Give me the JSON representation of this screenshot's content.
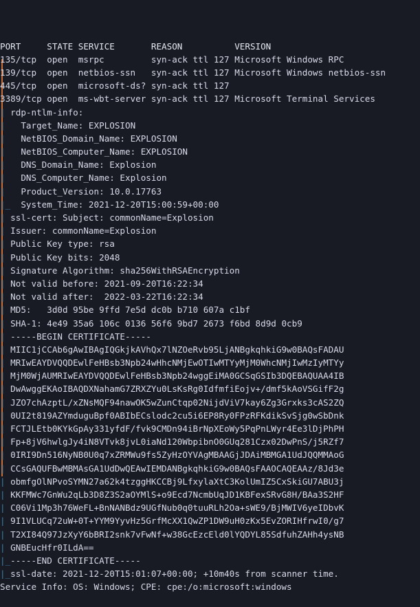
{
  "terminal": {
    "background_color": "#181a24",
    "foreground_color": "#d8dce8",
    "pipe_color": "#3d7fa6",
    "rule_color": "#c9703a",
    "columns_header": "PORT     STATE SERVICE       REASON          VERSION",
    "lines": [
      {
        "prefix": "",
        "text": "PORT     STATE SERVICE       REASON          VERSION",
        "kind": "header"
      },
      {
        "prefix": "",
        "text": "135/tcp  open  msrpc         syn-ack ttl 127 Microsoft Windows RPC",
        "kind": "port"
      },
      {
        "prefix": "",
        "text": "139/tcp  open  netbios-ssn   syn-ack ttl 127 Microsoft Windows netbios-ssn",
        "kind": "port"
      },
      {
        "prefix": "",
        "text": "445/tcp  open  microsoft-ds? syn-ack ttl 127",
        "kind": "port"
      },
      {
        "prefix": "",
        "text": "3389/tcp open  ms-wbt-server syn-ack ttl 127 Microsoft Terminal Services",
        "kind": "port"
      },
      {
        "prefix": "|",
        "text": " rdp-ntlm-info: ",
        "kind": "script"
      },
      {
        "prefix": "|",
        "text": "   Target_Name: EXPLOSION",
        "kind": "script"
      },
      {
        "prefix": "|",
        "text": "   NetBIOS_Domain_Name: EXPLOSION",
        "kind": "script"
      },
      {
        "prefix": "|",
        "text": "   NetBIOS_Computer_Name: EXPLOSION",
        "kind": "script"
      },
      {
        "prefix": "|",
        "text": "   DNS_Domain_Name: Explosion",
        "kind": "script"
      },
      {
        "prefix": "|",
        "text": "   DNS_Computer_Name: Explosion",
        "kind": "script"
      },
      {
        "prefix": "|",
        "text": "   Product_Version: 10.0.17763",
        "kind": "script"
      },
      {
        "prefix": "|_",
        "text": "  System_Time: 2021-12-20T15:00:59+00:00",
        "kind": "script"
      },
      {
        "prefix": "|",
        "text": " ssl-cert: Subject: commonName=Explosion",
        "kind": "script"
      },
      {
        "prefix": "|",
        "text": " Issuer: commonName=Explosion",
        "kind": "script"
      },
      {
        "prefix": "|",
        "text": " Public Key type: rsa",
        "kind": "script"
      },
      {
        "prefix": "|",
        "text": " Public Key bits: 2048",
        "kind": "script"
      },
      {
        "prefix": "|",
        "text": " Signature Algorithm: sha256WithRSAEncryption",
        "kind": "script"
      },
      {
        "prefix": "|",
        "text": " Not valid before: 2021-09-20T16:22:34",
        "kind": "script"
      },
      {
        "prefix": "|",
        "text": " Not valid after:  2022-03-22T16:22:34",
        "kind": "script"
      },
      {
        "prefix": "|",
        "text": " MD5:   3d0d 95be 9ffd 7e5d dc0b b710 607a c1bf",
        "kind": "script"
      },
      {
        "prefix": "|",
        "text": " SHA-1: 4e49 35a6 106c 0136 56f6 9bd7 2673 f6bd 8d9d 0cb9",
        "kind": "script"
      },
      {
        "prefix": "|",
        "text": " -----BEGIN CERTIFICATE-----",
        "kind": "script"
      },
      {
        "prefix": "|",
        "text": " MIIC1jCCAb6gAwIBAgIQGkjkAVhQx7lNZOeRvb95LjANBgkqhkiG9w0BAQsFADAU",
        "kind": "b64"
      },
      {
        "prefix": "|",
        "text": " MRIwEAYDVQQDEwlFeHBsb3Npb24wHhcNMjEwOTIwMTYyMjM0WhcNMjIwMzIyMTYy",
        "kind": "b64"
      },
      {
        "prefix": "|",
        "text": " MjM0WjAUMRIwEAYDVQQDEwlFeHBsb3Npb24wggEiMA0GCSqGSIb3DQEBAQUAA4IB",
        "kind": "b64"
      },
      {
        "prefix": "|",
        "text": " DwAwggEKAoIBAQDXNahamG7ZRXZYu0LsKsRg0IdfmfiEojv+/dmf5kAoVSGifF2g",
        "kind": "b64"
      },
      {
        "prefix": "|",
        "text": " JZO7chAzptL/xZNsMQF94nawOK5wZunCtqp02NijdViV7kay6Zg3Grxks3cAS2ZQ",
        "kind": "b64"
      },
      {
        "prefix": "|",
        "text": " 0UI2t819AZYmduguBpf0ABIbECslodc2cu5i6EP8Ry0FPzRFKdikSvSjg0wSbDnk",
        "kind": "b64"
      },
      {
        "prefix": "|",
        "text": " FCTJLEtb0KYkGpAy331yfdF/fvk9CMDn94iBrNpXEoWy5PqPnLWyr4Ee3lDjPhPH",
        "kind": "b64"
      },
      {
        "prefix": "|",
        "text": " Fp+8jV6hwlgJy4iN8VTvk8jvL0iaNd120WbpibnO0GUq281Czx02DwPnS/j5RZf7",
        "kind": "b64"
      },
      {
        "prefix": "|",
        "text": " 0IRI9Dn516NyNB0U0q7xZRMWu9fs5ZyHzOYVAgMBAAGjJDAiMBMGA1UdJQQMMAoG",
        "kind": "b64"
      },
      {
        "prefix": "|",
        "text": " CCsGAQUFBwMBMAsGA1UdDwQEAwIEMDANBgkqhkiG9w0BAQsFAAOCAQEAAz/8Jd3e",
        "kind": "b64"
      },
      {
        "prefix": "|",
        "text": " obmfgOlNPvoSYMN27a62k4tzggHKCCBj9LfxylaXtC3KolUmIZ5CxSkiGU7ABU3j",
        "kind": "b64"
      },
      {
        "prefix": "|",
        "text": " KKFMWc7GnWu2qLb3D8Z3S2aOYMlS+o9Ecd7NcmbUqJD1KBFexSRvG8H/BAa3S2HF",
        "kind": "b64"
      },
      {
        "prefix": "|",
        "text": " C06Vi1Mp3h76WeFL+BnNANBdz9UGfNub0q0tuuRLh2Oa+sWE9/BjMWIV6yeIDbvK",
        "kind": "b64"
      },
      {
        "prefix": "|",
        "text": " 9I1VLUCq72uW+0T+YYM9YyvHz5GrfMcXX1QwZP1DW9uH0zKx5EvZORIHfrwI0/g7",
        "kind": "b64"
      },
      {
        "prefix": "|",
        "text": " T2XI84Q97JzXyY6bBRI2snk7vFwNf+w38GcEzcEld0lYQDYL85SdfuhZAHh4ysNB",
        "kind": "b64"
      },
      {
        "prefix": "|",
        "text": " GNBEucHfr0ILdA==",
        "kind": "b64"
      },
      {
        "prefix": "|_",
        "text": "-----END CERTIFICATE-----",
        "kind": "script"
      },
      {
        "prefix": "|_",
        "text": "ssl-date: 2021-12-20T15:01:07+00:00; +10m40s from scanner time.",
        "kind": "script"
      },
      {
        "prefix": "",
        "text": "Service Info: OS: Windows; CPE: cpe:/o:microsoft:windows",
        "kind": "info"
      }
    ]
  }
}
